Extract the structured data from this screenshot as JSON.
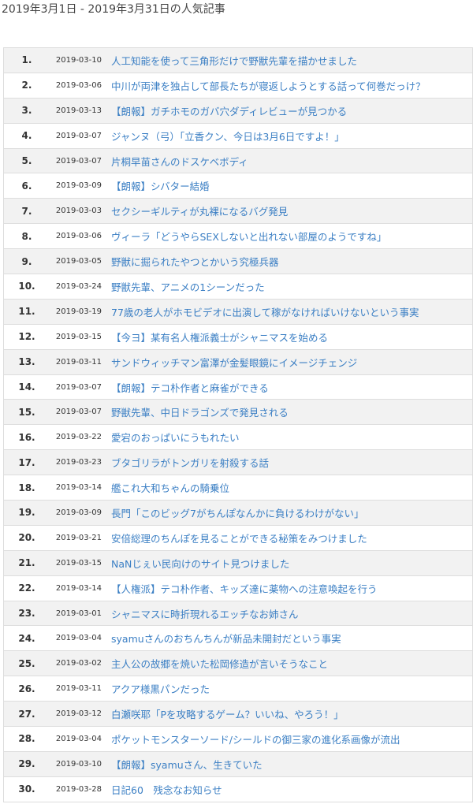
{
  "header": {
    "title": "2019年3月1日 - 2019年3月31日の人気記事"
  },
  "colors": {
    "link": "#3b7fc4",
    "stripe": "#f2f2f2",
    "border": "#dddddd",
    "text": "#333333"
  },
  "ranking": [
    {
      "rank": "1.",
      "date": "2019-03-10",
      "title": "人工知能を使って三角形だけで野獣先輩を描かせました"
    },
    {
      "rank": "2.",
      "date": "2019-03-06",
      "title": "中川が両津を独占して部長たちが寝返しようとする話って何巻だっけ？"
    },
    {
      "rank": "3.",
      "date": "2019-03-13",
      "title": "【朗報】ガチホモのガバ穴ダディレビューが見つかる"
    },
    {
      "rank": "4.",
      "date": "2019-03-07",
      "title": "ジャンヌ（弓）「立香クン、今日は3月6日ですよ！」"
    },
    {
      "rank": "5.",
      "date": "2019-03-07",
      "title": "片桐早苗さんのドスケベボディ"
    },
    {
      "rank": "6.",
      "date": "2019-03-09",
      "title": "【朗報】シバター結婚"
    },
    {
      "rank": "7.",
      "date": "2019-03-03",
      "title": "セクシーギルティが丸裸になるバグ発見"
    },
    {
      "rank": "8.",
      "date": "2019-03-06",
      "title": "ヴィーラ「どうやらSEXしないと出れない部屋のようですね」"
    },
    {
      "rank": "9.",
      "date": "2019-03-05",
      "title": "野獣に掘られたやつとかいう究極兵器"
    },
    {
      "rank": "10.",
      "date": "2019-03-24",
      "title": "野獣先輩、アニメの1シーンだった"
    },
    {
      "rank": "11.",
      "date": "2019-03-19",
      "title": "77歳の老人がホモビデオに出演して稼がなければいけないという事実"
    },
    {
      "rank": "12.",
      "date": "2019-03-15",
      "title": "【今ヨ】某有名人権派義士がシャニマスを始める"
    },
    {
      "rank": "13.",
      "date": "2019-03-11",
      "title": "サンドウィッチマン富澤が金髪眼鏡にイメージチェンジ"
    },
    {
      "rank": "14.",
      "date": "2019-03-07",
      "title": "【朗報】テコ朴作者と麻雀ができる"
    },
    {
      "rank": "15.",
      "date": "2019-03-07",
      "title": "野獣先輩、中日ドラゴンズで発見される"
    },
    {
      "rank": "16.",
      "date": "2019-03-22",
      "title": "愛宕のおっぱいにうもれたい"
    },
    {
      "rank": "17.",
      "date": "2019-03-23",
      "title": "ブタゴリラがトンガリを射殺する話"
    },
    {
      "rank": "18.",
      "date": "2019-03-14",
      "title": "艦これ大和ちゃんの騎乗位"
    },
    {
      "rank": "19.",
      "date": "2019-03-09",
      "title": "長門「このビッグ7がちんぽなんかに負けるわけがない」"
    },
    {
      "rank": "20.",
      "date": "2019-03-21",
      "title": "安倍総理のちんぽを見ることができる秘策をみつけました"
    },
    {
      "rank": "21.",
      "date": "2019-03-15",
      "title": "NaNじぇい民向けのサイト見つけました"
    },
    {
      "rank": "22.",
      "date": "2019-03-14",
      "title": "【人権派】テコ朴作者、キッズ達に薬物への注意喚起を行う"
    },
    {
      "rank": "23.",
      "date": "2019-03-01",
      "title": "シャニマスに時折現れるエッチなお姉さん"
    },
    {
      "rank": "24.",
      "date": "2019-03-04",
      "title": "syamuさんのおちんちんが新品未開封だという事実"
    },
    {
      "rank": "25.",
      "date": "2019-03-02",
      "title": "主人公の故郷を焼いた松岡修造が言いそうなこと"
    },
    {
      "rank": "26.",
      "date": "2019-03-11",
      "title": "アクア様黒パンだった"
    },
    {
      "rank": "27.",
      "date": "2019-03-12",
      "title": "白瀬咲耶「Pを攻略するゲーム？いいね、やろう！」"
    },
    {
      "rank": "28.",
      "date": "2019-03-04",
      "title": "ポケットモンスターソード/シールドの御三家の進化系画像が流出"
    },
    {
      "rank": "29.",
      "date": "2019-03-10",
      "title": "【朗報】syamuさん、生きていた"
    },
    {
      "rank": "30.",
      "date": "2019-03-28",
      "title": "日記60　残念なお知らせ"
    }
  ]
}
